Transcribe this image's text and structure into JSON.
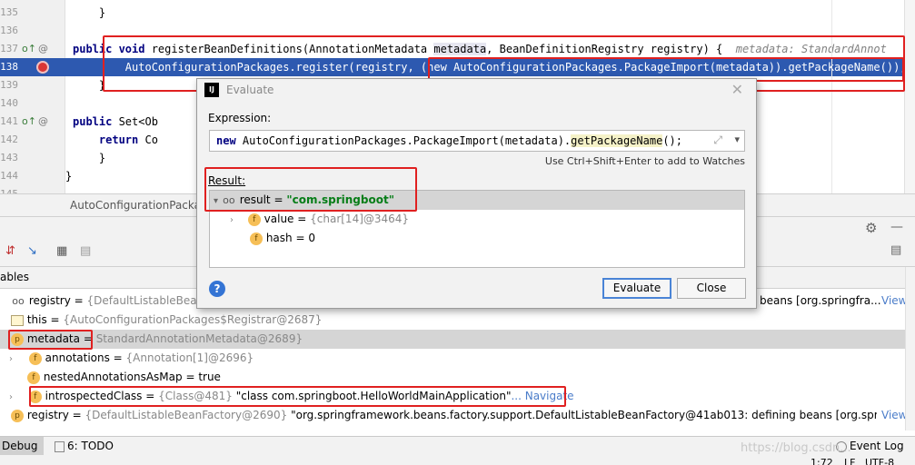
{
  "editor": {
    "lines": [
      {
        "num": "135",
        "text": "    }"
      },
      {
        "num": "136",
        "text": ""
      },
      {
        "num": "137",
        "text": "    public void registerBeanDefinitions(AnnotationMetadata metadata, BeanDefinitionRegistry registry) {",
        "hint": "metadata: StandardAnnot"
      },
      {
        "num": "138",
        "text": "        AutoConfigurationPackages.register(registry, (new AutoConfigurationPackages.PackageImport(metadata)).getPackageName());"
      },
      {
        "num": "139",
        "text": "    }"
      },
      {
        "num": "140",
        "text": ""
      },
      {
        "num": "141",
        "text": "    public Set<Ob"
      },
      {
        "num": "142",
        "text": "        return Co"
      },
      {
        "num": "143",
        "text": "    }"
      },
      {
        "num": "144",
        "text": "}"
      },
      {
        "num": "145",
        "text": "}"
      }
    ],
    "breadcrumb": "AutoConfigurationPacka"
  },
  "dialog": {
    "title": "Evaluate",
    "logo": "IJ",
    "expression_label": "Expression:",
    "expression_prefix": "new",
    "expression_main": " AutoConfigurationPackages.PackageImport(metadata).",
    "expression_method": "getPackageName",
    "expression_suffix": "();",
    "watch_hint": "Use Ctrl+Shift+Enter to add to Watches",
    "result_label": "Result:",
    "result_rows": [
      {
        "name": "result",
        "eq": " = ",
        "value": "\"com.springboot\""
      },
      {
        "name": "value",
        "eq": " = ",
        "value": "{char[14]@3464}"
      },
      {
        "name": "hash",
        "eq": " = ",
        "value": "0"
      }
    ],
    "evaluate_label": "Evaluate",
    "close_label": "Close",
    "help": "?"
  },
  "debug": {
    "vars_header": "ables",
    "vars": [
      {
        "name": "registry",
        "type": "{DefaultListableBeanFac",
        "tail": "beans [org.springfra...",
        "link": "View"
      },
      {
        "name": "this",
        "type": "{AutoConfigurationPackages$Registrar@2687}"
      },
      {
        "name": "metadata",
        "type": "StandardAnnotationMetadata@2689}"
      },
      {
        "name": "annotations",
        "type": "{Annotation[1]@2696}"
      },
      {
        "name": "nestedAnnotationsAsMap",
        "value": "true"
      },
      {
        "name": "introspectedClass",
        "type": "{Class@481}",
        "value": "\"class com.springboot.HelloWorldMainApplication\"",
        "link": "... Navigate"
      },
      {
        "name": "registry",
        "type": "{DefaultListableBeanFactory@2690}",
        "value": "\"org.springframework.beans.factory.support.DefaultListableBeanFactory@41ab013: defining beans [org.springfra...",
        "link": "View"
      }
    ]
  },
  "statusbar": {
    "debug_tab": "Debug",
    "todo_tab": "6: TODO",
    "event_log": "Event Log",
    "position": "1:72",
    "lf": "LF",
    "encoding": "UTF-8"
  },
  "watermark": "https://blog.csdn..."
}
